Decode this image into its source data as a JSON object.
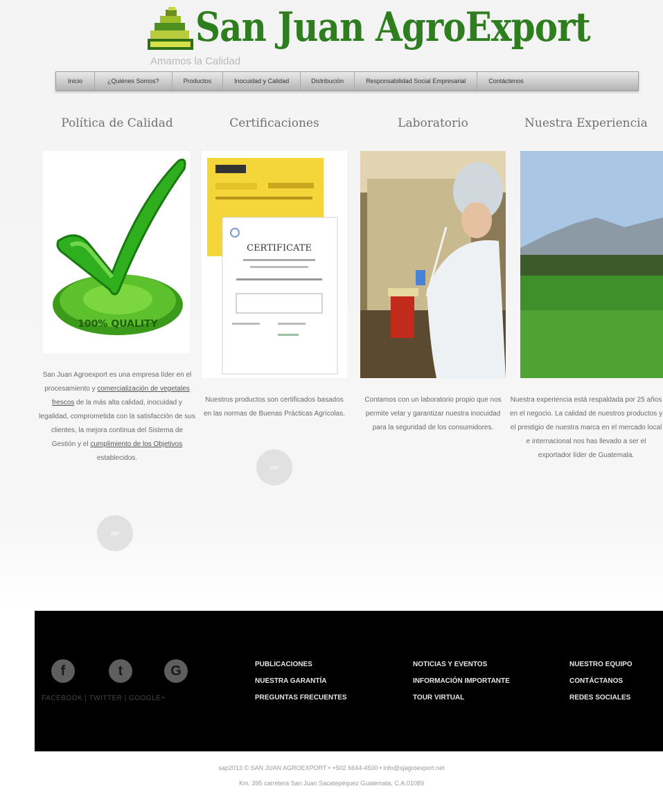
{
  "header": {
    "title": "San Juan AgroExport",
    "tagline": "Amamos la Calidad"
  },
  "nav": {
    "items": [
      "Inicio",
      "¿Quiénes Somos?",
      "Productos",
      "Inocuidad y Calidad",
      "Distribución",
      "Responsabilidad Social Empresarial",
      "Contáctenos"
    ]
  },
  "columns": [
    {
      "title": "Política de Calidad",
      "text_parts": [
        "San Juan Agroexport es una empresa líder en el procesamiento y ",
        "comercialización de vegetales frescos",
        " de la más alta calidad, inocuidad y legalidad, comprometida con la satisfacción de sus clientes, la mejora continua del Sistema de Gestión y el ",
        "cumplimiento de los Objetivos",
        " establecidos."
      ],
      "button": "ver"
    },
    {
      "title": "Certificaciones",
      "text": "Nuestros productos son certificados basados en las normas de Buenas Prácticas Agrícolas.",
      "button": "ver"
    },
    {
      "title": "Laboratorio",
      "text": "Contamos con un laboratorio propio que nos permite velar y garantizar nuestra inocuidad para la seguridad de los consumidores."
    },
    {
      "title": "Nuestra Experiencia",
      "text": "Nuestra experiencia está respaldada por 25 años en el negocio. La calidad de nuestros productos y el prestigio de nuestra marca en el mercado local e internacional nos has llevado a ser el exportador líder de Guatemala."
    }
  ],
  "certificate": {
    "heading": "CERTIFICATE"
  },
  "quality_seal": {
    "text": "100% QUALITY"
  },
  "footer": {
    "social_labels": "FACEBOOK | TWITTER | GOOGLE+",
    "icons": [
      "facebook-icon",
      "twitter-icon",
      "google-icon"
    ],
    "links_col1": [
      "PUBLICACIONES",
      "NUESTRA GARANTÍA",
      "PREGUNTAS FRECUENTES"
    ],
    "links_col2": [
      "NOTICIAS Y EVENTOS",
      "INFORMACIÓN IMPORTANTE",
      "TOUR VIRTUAL"
    ],
    "links_col3": [
      "NUESTRO EQUIPO",
      "CONTÁCTANOS",
      "REDES SOCIALES"
    ]
  },
  "copyright": {
    "line1": "sap2013 © SAN JUAN AGROEXPORT • +502 6644-4500 • info@sjagroexport.net",
    "line2": "Km. 395 carretera San Juan Sacatepéquez Guatemala, C.A.01089"
  },
  "colors": {
    "brand_green": "#2e7d1f",
    "footer_bg": "#000000"
  }
}
